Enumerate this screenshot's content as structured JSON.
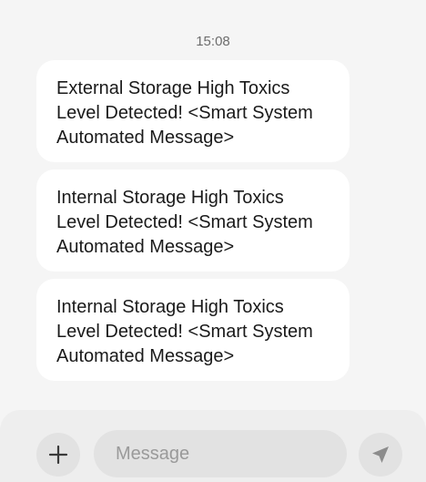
{
  "conversation": {
    "timestamp": "15:08",
    "messages": [
      {
        "text": "External Storage High Toxics\nLevel Detected! <Smart System\nAutomated Message>"
      },
      {
        "text": "Internal Storage High Toxics\nLevel Detected! <Smart System\nAutomated Message>"
      },
      {
        "text": "Internal Storage High Toxics\nLevel Detected! <Smart System\nAutomated Message>"
      }
    ]
  },
  "composer": {
    "placeholder": "Message",
    "attach_icon": "plus-icon",
    "send_icon": "send-icon"
  },
  "colors": {
    "background": "#f5f5f5",
    "bubble": "#ffffff",
    "control": "#e2e2e2",
    "icon": "#3a3a3a",
    "send_icon": "#8c8c8c"
  }
}
